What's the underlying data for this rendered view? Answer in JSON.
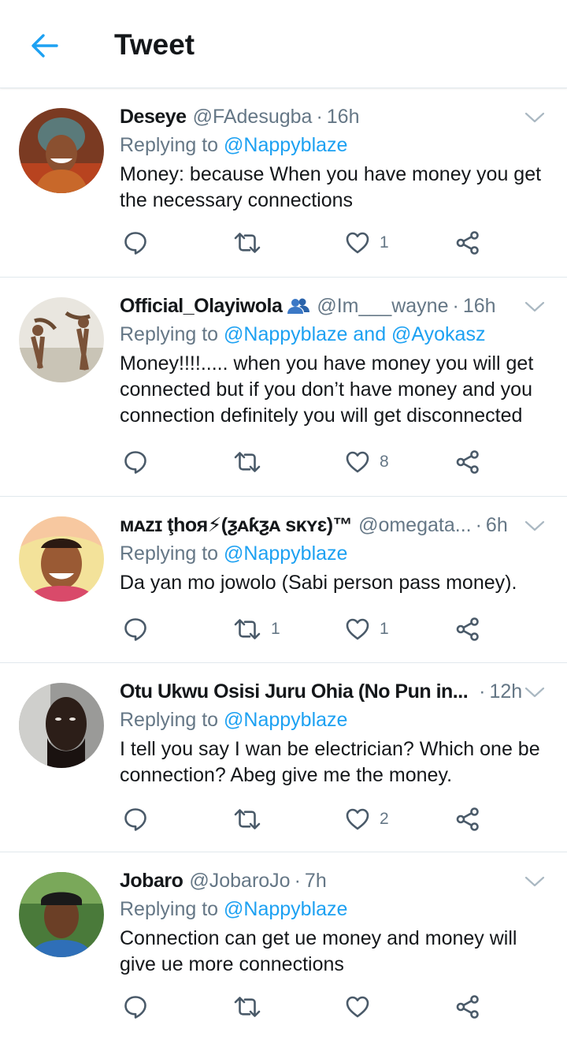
{
  "header": {
    "title": "Tweet",
    "back_icon": "back-arrow-icon",
    "accent": "#1da1f2"
  },
  "tweets": [
    {
      "name": "Deseye",
      "handle": "@FAdesugba",
      "dot": "·",
      "time": "16h",
      "reply_prefix": "Replying to ",
      "reply_mentions": "@Nappyblaze",
      "text": "Money: because When you have money you get the necessary connections",
      "counts": {
        "reply": "",
        "retweet": "",
        "like": "1"
      }
    },
    {
      "name": "Official_Olayiwola",
      "handle": "@Im___wayne",
      "dot": "·",
      "time": "16h",
      "reply_prefix": "Replying to ",
      "reply_mentions": "@Nappyblaze and @Ayokasz",
      "text": "Money!!!!..... when you have money you will get connected but if you don’t have money and you connection definitely you will get disconnected",
      "counts": {
        "reply": "",
        "retweet": "",
        "like": "8"
      }
    },
    {
      "name": "ᴍᴀᴢɪ ţhoя⚡(ƺᴀƙƺᴀ sᴋʏɛ)™",
      "handle": "@omegata...",
      "dot": "·",
      "time": "6h",
      "reply_prefix": "Replying to ",
      "reply_mentions": "@Nappyblaze",
      "text": "Da yan mo jowolo (Sabi person pass money).",
      "counts": {
        "reply": "",
        "retweet": "1",
        "like": "1"
      }
    },
    {
      "name": "Otu Ukwu Osisi Juru Ohia (No Pun in...",
      "handle": "",
      "dot": "·",
      "time": "12h",
      "reply_prefix": "Replying to ",
      "reply_mentions": "@Nappyblaze",
      "text": "I tell you say I wan be electrician? Which one be connection? Abeg give me the money.",
      "counts": {
        "reply": "",
        "retweet": "",
        "like": "2"
      }
    },
    {
      "name": "Jobaro",
      "handle": "@JobaroJo",
      "dot": "·",
      "time": "7h",
      "reply_prefix": "Replying to ",
      "reply_mentions": "@Nappyblaze",
      "text": "Connection can get ue money and money will give ue more connections",
      "counts": {
        "reply": "",
        "retweet": "",
        "like": ""
      }
    }
  ],
  "icons": {
    "reply": "reply-bubble-icon",
    "retweet": "retweet-icon",
    "like": "heart-icon",
    "share": "share-icon",
    "caret": "chevron-down-icon",
    "group_badge": "people-icon"
  },
  "colors": {
    "text": "#14171a",
    "muted": "#657786",
    "link": "#1da1f2",
    "divider": "#e1e8ed"
  }
}
